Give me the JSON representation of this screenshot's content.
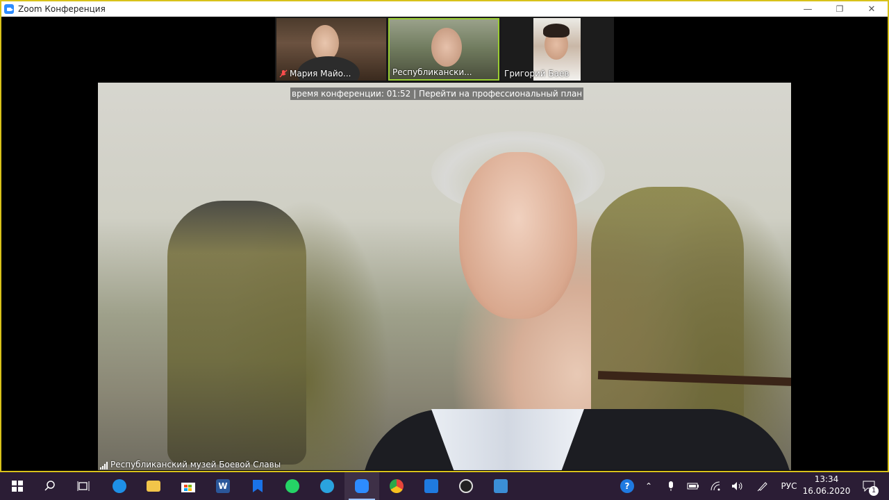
{
  "window": {
    "title": "Zoom Конференция",
    "controls": {
      "minimize": "—",
      "restore": "❐",
      "close": "✕"
    }
  },
  "participants": [
    {
      "name": "Мария Майо...",
      "muted": true
    },
    {
      "name": "Республикански...",
      "active": true
    },
    {
      "name": "Григорий Баев"
    }
  ],
  "meeting": {
    "timer_text": "время конференции: 01:52 | Перейти на профессиональный план",
    "active_speaker": "Республиканский музей Боевой Славы"
  },
  "taskbar": {
    "apps": [
      {
        "id": "start",
        "icon": "windows-start-icon"
      },
      {
        "id": "search",
        "icon": "search-icon"
      },
      {
        "id": "taskview",
        "icon": "task-view-icon"
      },
      {
        "id": "edge",
        "icon": "edge-icon",
        "color": "#1e8fe6"
      },
      {
        "id": "explorer",
        "icon": "folder-icon",
        "color": "#f2c54a"
      },
      {
        "id": "store",
        "icon": "store-icon",
        "color": "#ffffff"
      },
      {
        "id": "word",
        "icon": "word-icon",
        "color": "#2b579a"
      },
      {
        "id": "bookmark",
        "icon": "bookmark-icon",
        "color": "#1a73e8"
      },
      {
        "id": "whatsapp",
        "icon": "whatsapp-icon",
        "color": "#25d366"
      },
      {
        "id": "telegram",
        "icon": "telegram-icon",
        "color": "#2aa3de"
      },
      {
        "id": "zoom",
        "icon": "zoom-icon",
        "color": "#2d8cff",
        "active": true
      },
      {
        "id": "chrome",
        "icon": "chrome-icon",
        "color": "#e6453b"
      },
      {
        "id": "calendar",
        "icon": "calendar-icon",
        "color": "#1f7ae0"
      },
      {
        "id": "obs",
        "icon": "obs-icon",
        "color": "#222222"
      },
      {
        "id": "photos",
        "icon": "photos-icon",
        "color": "#3b8ed6"
      }
    ],
    "tray": {
      "language": "РУС",
      "time": "13:34",
      "date": "16.06.2020",
      "notifications": "1"
    }
  }
}
